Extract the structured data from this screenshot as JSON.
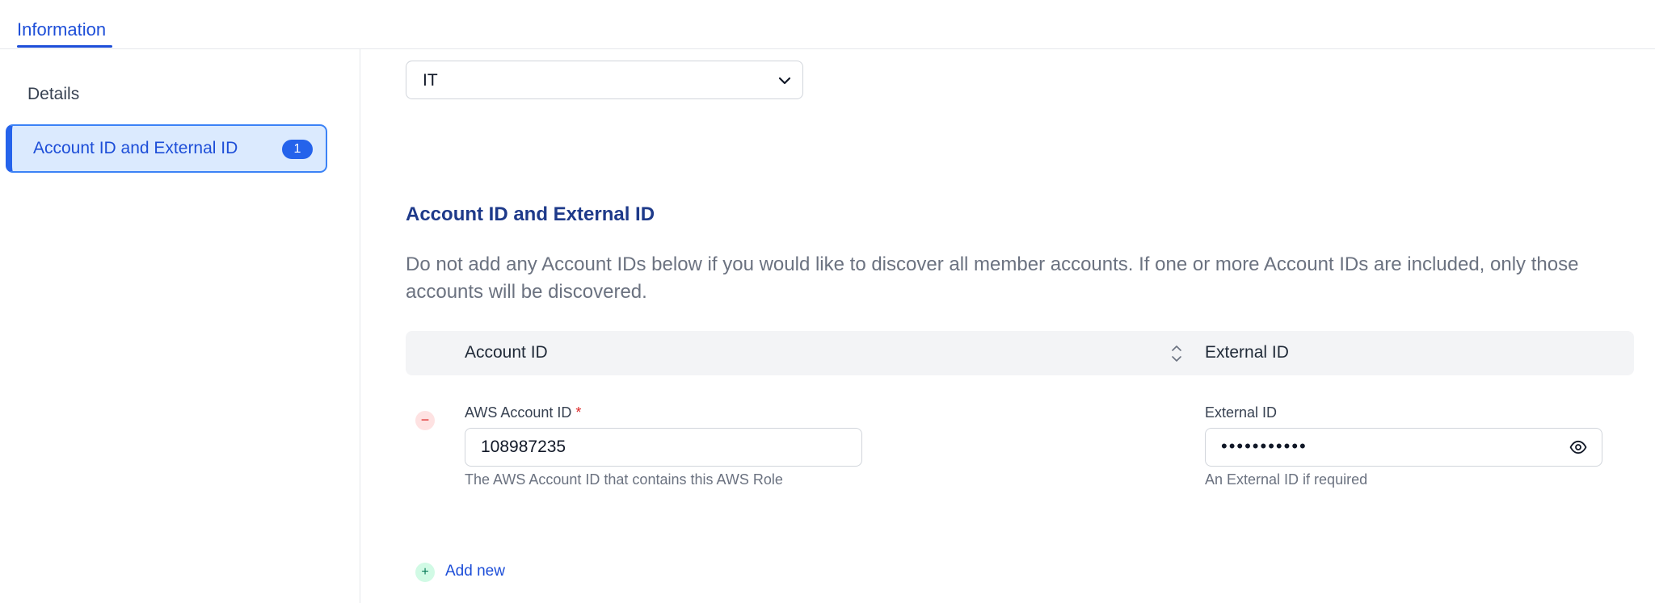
{
  "tabs": [
    {
      "label": "Information",
      "active": true
    }
  ],
  "sidebar": {
    "items": [
      {
        "label": "Details"
      },
      {
        "label": "Account ID and External ID",
        "badge": "1",
        "active": true
      }
    ]
  },
  "main": {
    "select": {
      "value": "IT"
    },
    "section": {
      "title": "Account ID and External ID",
      "description": "Do not add any Account IDs below if you would like to discover all member accounts. If one or more Account IDs are included, only those accounts will be discovered."
    },
    "table": {
      "headers": {
        "account": "Account ID",
        "external": "External ID"
      },
      "rows": [
        {
          "account_label": "AWS Account ID",
          "required_mark": "*",
          "account_value": "108987235",
          "account_help": "The AWS Account ID that contains this AWS Role",
          "external_label": "External ID",
          "external_value": "•••••••••••",
          "external_help": "An External ID if required"
        }
      ]
    },
    "remove_symbol": "−",
    "add_symbol": "+",
    "add_new_label": "Add new"
  },
  "colors": {
    "accent": "#1d4ed8",
    "active_bg": "#dbeafe",
    "danger": "#dc2626",
    "success_bg": "#d1fae5"
  },
  "icons": [
    "chevron-down-icon",
    "sort-icon",
    "eye-icon",
    "minus-icon",
    "plus-icon"
  ]
}
